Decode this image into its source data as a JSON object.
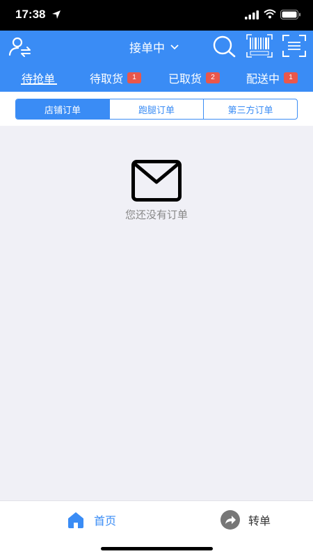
{
  "status_bar": {
    "time": "17:38"
  },
  "header": {
    "status_select": "接单中",
    "tabs": [
      {
        "label": "待抢单"
      },
      {
        "label": "待取货",
        "badge": "1"
      },
      {
        "label": "已取货",
        "badge": "2"
      },
      {
        "label": "配送中",
        "badge": "1"
      }
    ]
  },
  "segments": [
    "店铺订单",
    "跑腿订单",
    "第三方订单"
  ],
  "empty_state": {
    "message": "您还没有订单"
  },
  "bottom_nav": [
    {
      "label": "首页",
      "icon": "home-icon"
    },
    {
      "label": "转单",
      "icon": "forward-icon"
    }
  ],
  "colors": {
    "primary": "#3a8cf5",
    "badge": "#e9574b",
    "background": "#f0f0f6"
  }
}
